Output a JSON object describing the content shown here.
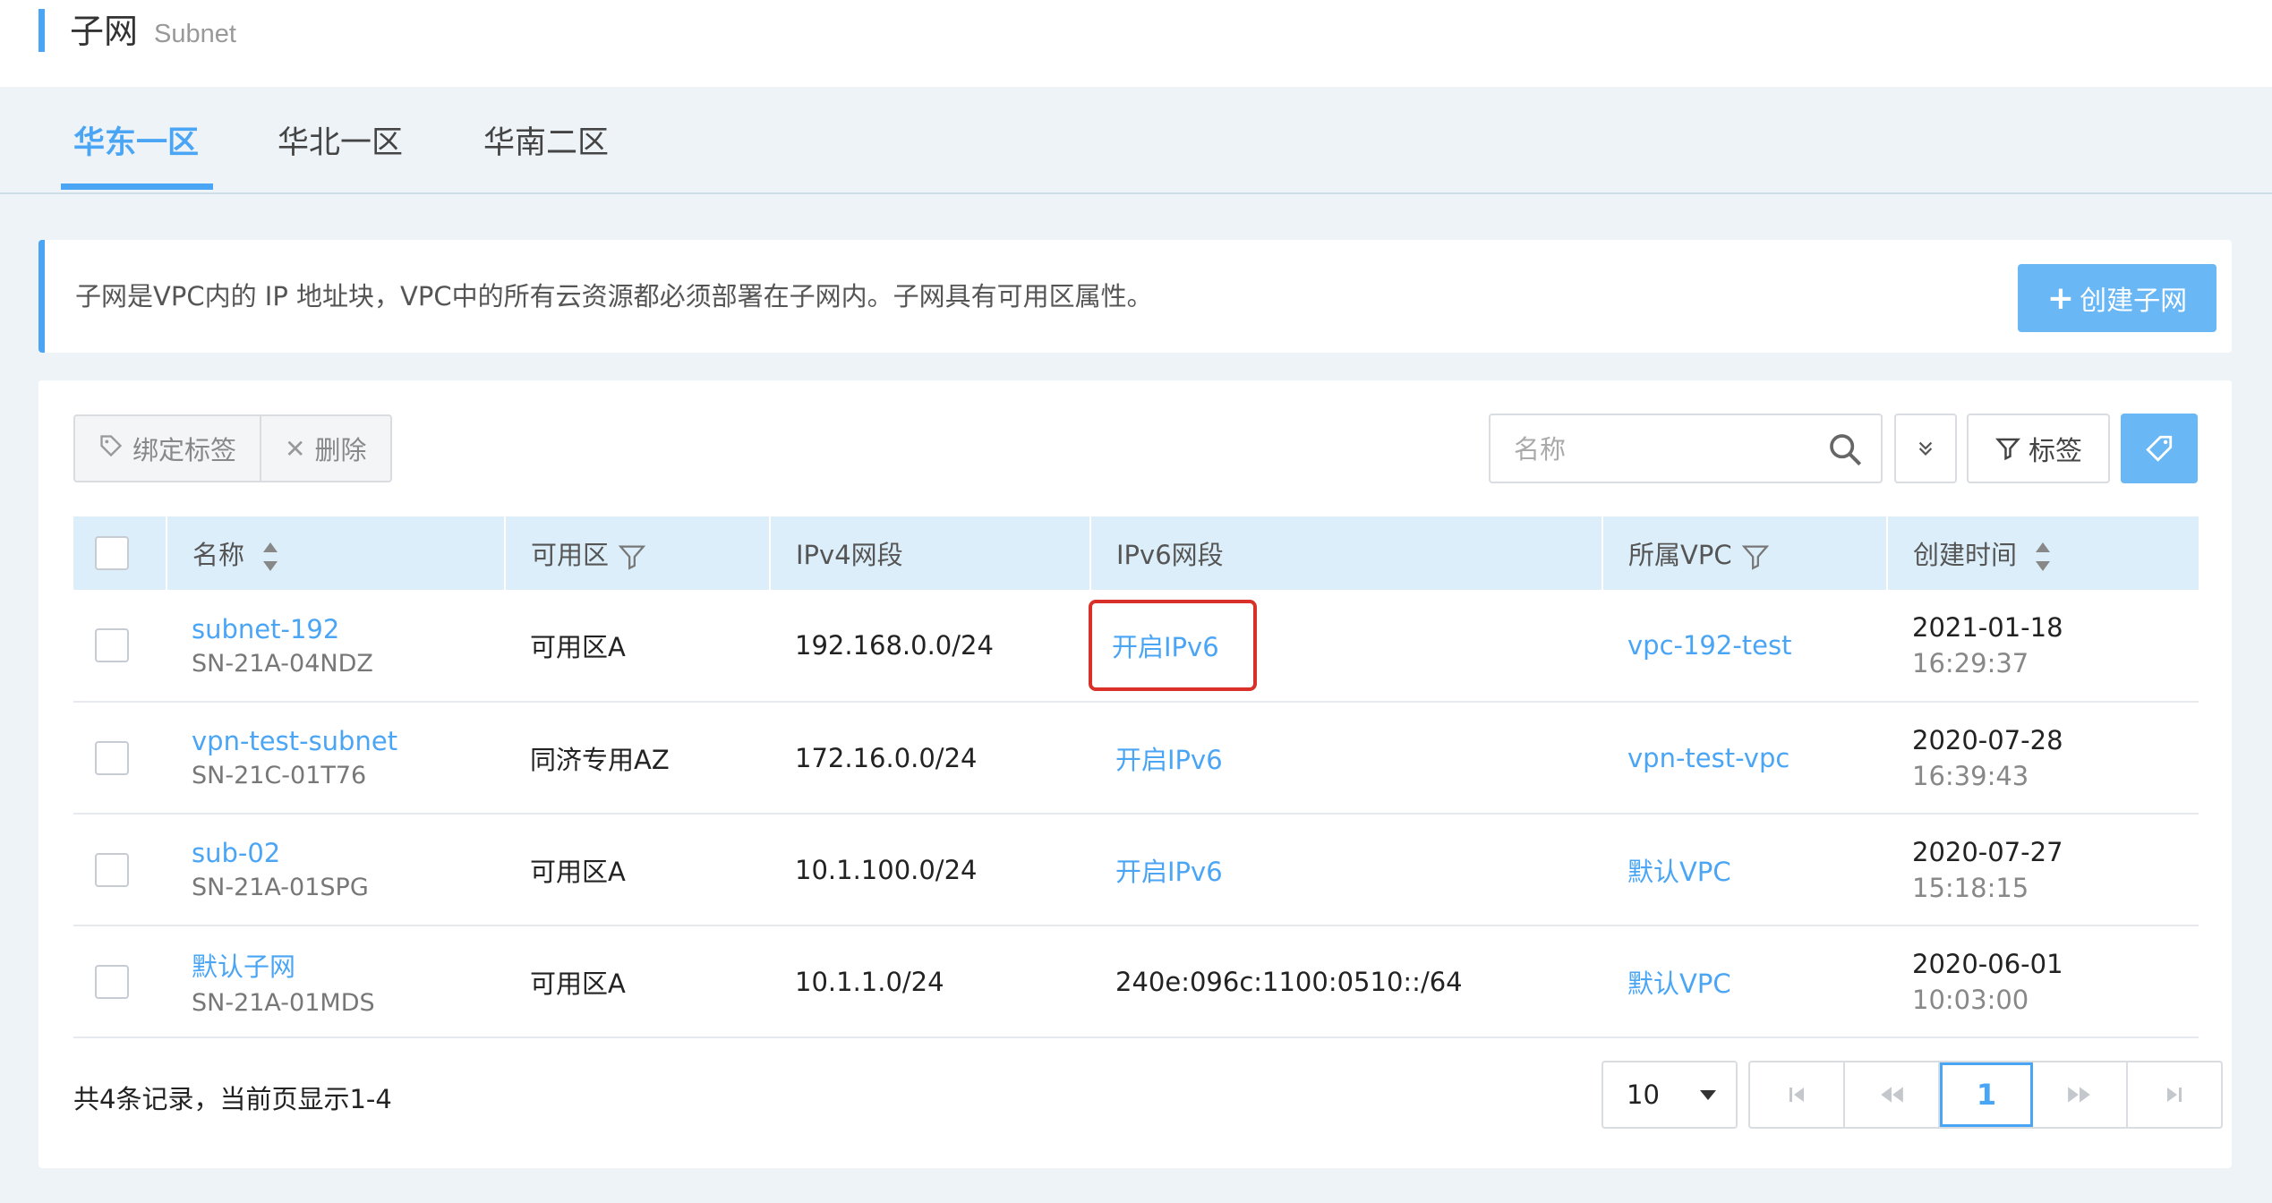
{
  "header": {
    "title": "子网",
    "subtitle": "Subnet"
  },
  "tabs": [
    {
      "label": "华东一区",
      "active": true
    },
    {
      "label": "华北一区",
      "active": false
    },
    {
      "label": "华南二区",
      "active": false
    }
  ],
  "info": {
    "text": "子网是VPC内的 IP 地址块，VPC中的所有云资源都必须部署在子网内。子网具有可用区属性。",
    "create_button": "创建子网"
  },
  "toolbar": {
    "bind_tag": "绑定标签",
    "delete": "删除",
    "search_placeholder": "名称",
    "tag_filter": "标签"
  },
  "table": {
    "columns": [
      "名称",
      "可用区",
      "IPv4网段",
      "IPv6网段",
      "所属VPC",
      "创建时间"
    ],
    "rows": [
      {
        "name": "subnet-192",
        "id": "SN-21A-04NDZ",
        "zone": "可用区A",
        "ipv4": "192.168.0.0/24",
        "ipv6": "开启IPv6",
        "vpc": "vpc-192-test",
        "date": "2021-01-18",
        "time": "16:29:37"
      },
      {
        "name": "vpn-test-subnet",
        "id": "SN-21C-01T76",
        "zone": "同济专用AZ",
        "ipv4": "172.16.0.0/24",
        "ipv6": "开启IPv6",
        "vpc": "vpn-test-vpc",
        "date": "2020-07-28",
        "time": "16:39:43"
      },
      {
        "name": "sub-02",
        "id": "SN-21A-01SPG",
        "zone": "可用区A",
        "ipv4": "10.1.100.0/24",
        "ipv6": "开启IPv6",
        "vpc": "默认VPC",
        "date": "2020-07-27",
        "time": "15:18:15"
      },
      {
        "name": "默认子网",
        "id": "SN-21A-01MDS",
        "zone": "可用区A",
        "ipv4": "10.1.1.0/24",
        "ipv6": "240e:096c:1100:0510::/64",
        "vpc": "默认VPC",
        "date": "2020-06-01",
        "time": "10:03:00"
      }
    ]
  },
  "footer": {
    "summary": "共4条记录，当前页显示1-4",
    "page_size": "10",
    "current_page": "1"
  },
  "colors": {
    "accent": "#4aa5f5",
    "highlight": "#d9312a",
    "header_row": "#dceef9"
  }
}
